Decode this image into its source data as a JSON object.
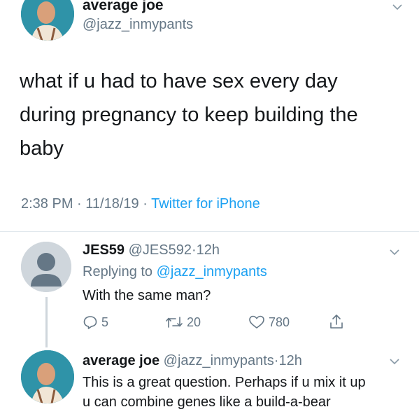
{
  "main_tweet": {
    "name": "average joe",
    "handle": "@jazz_inmypants",
    "text": "what if u had to have sex every day during pregnancy to keep building the baby",
    "time": "2:38 PM",
    "dot1": "·",
    "date": "11/18/19",
    "dot2": "·",
    "source": "Twitter for iPhone"
  },
  "reply1": {
    "name": "JES59",
    "handle": "@JES592",
    "dot": "·",
    "age": "12h",
    "replying_prefix": "Replying to",
    "replying_mention": "@jazz_inmypants",
    "text": "With the same man?",
    "actions": {
      "reply_count": "5",
      "retweet_count": "20",
      "like_count": "780"
    }
  },
  "reply2": {
    "name": "average joe",
    "handle": "@jazz_inmypants",
    "dot": "·",
    "age": "12h",
    "text_line1": "This is a great question. Perhaps if u mix it up",
    "text_line2": "u can combine genes like a build-a-bear"
  },
  "colors": {
    "accent": "#1da1f2",
    "secondary_text": "#657786",
    "avatar_bg": "#2f93a8"
  },
  "icons": [
    "chevron-down-icon",
    "reply-icon",
    "retweet-icon",
    "like-icon",
    "share-icon",
    "default-avatar-icon"
  ]
}
